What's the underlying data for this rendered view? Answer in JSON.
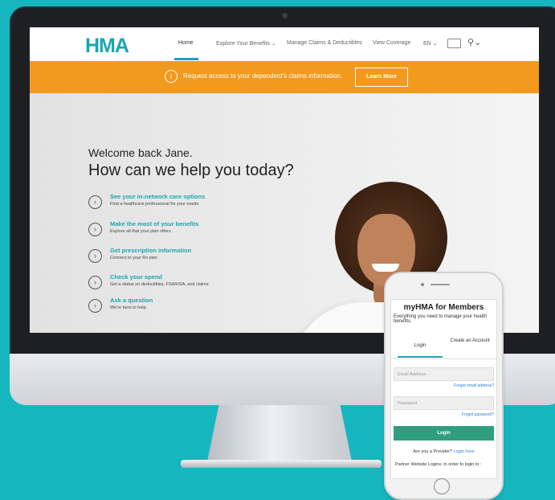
{
  "site": {
    "logo": "HMA",
    "nav": {
      "home": "Home",
      "benefits": "Explore Your Benefits",
      "claims": "Manage Claims & Deductibles",
      "coverage": "View Coverage",
      "language": "EN"
    },
    "banner": {
      "message": "Request access to your dependent's claims information.",
      "button": "Learn More"
    },
    "hero": {
      "welcome": "Welcome back Jane.",
      "headline": "How can we help you today?"
    },
    "options": [
      {
        "title": "See your in-network care options",
        "desc": "Find a healthcare professional for your needs"
      },
      {
        "title": "Make the most of your benefits",
        "desc": "Explore all that your plan offers"
      },
      {
        "title": "Get prescription information",
        "desc": "Connect to your Rx plan"
      },
      {
        "title": "Check your spend",
        "desc": "Get a status on deductibles, FSA/HSA, and claims"
      },
      {
        "title": "Ask a question",
        "desc": "We're here to help"
      }
    ]
  },
  "app": {
    "title": "myHMA for Members",
    "subtitle": "Everything you need to manage your health benefits.",
    "tabs": {
      "login": "Login",
      "create": "Create an Account"
    },
    "email_placeholder": "Email Address",
    "forgot_email": "Forgot email address?",
    "password_placeholder": "Password",
    "forgot_password": "Forgot password?",
    "login_button": "Login",
    "provider_prompt": "Are you a Provider?",
    "provider_link": "Login here",
    "partner_text": "Partner Website Logins: In order to login to :"
  },
  "colors": {
    "background": "#16b6bf",
    "brand_teal": "#19a7b0",
    "banner_orange": "#f29a1e",
    "login_green": "#2e9e7e"
  },
  "icons": [
    "info-icon",
    "chevron-right-icon",
    "card-icon",
    "user-icon",
    "chevron-down-icon"
  ]
}
